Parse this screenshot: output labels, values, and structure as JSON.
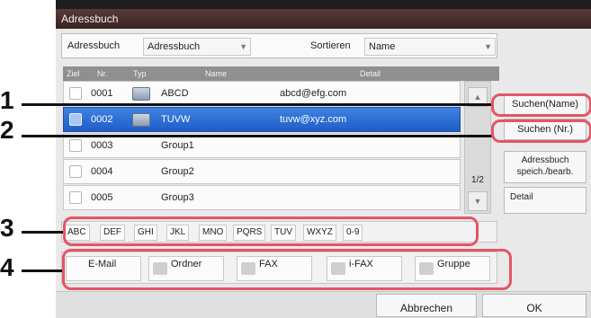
{
  "window": {
    "title": "Adressbuch"
  },
  "topbar": {
    "addressbook_label": "Adressbuch",
    "addressbook_value": "Adressbuch",
    "sort_label": "Sortieren",
    "sort_value": "Name"
  },
  "columns": {
    "target": "Ziel",
    "number": "Nr.",
    "type": "Typ",
    "name": "Name",
    "detail": "Detail"
  },
  "entries": [
    {
      "number": "0001",
      "type_icon": "email-contact-icon",
      "name": "ABCD",
      "detail": "abcd@efg.com",
      "selected": false
    },
    {
      "number": "0002",
      "type_icon": "email-contact-icon",
      "name": "TUVW",
      "detail": "tuvw@xyz.com",
      "selected": true
    },
    {
      "number": "0003",
      "type_icon": "group-icon",
      "name": "Group1",
      "detail": "",
      "selected": false
    },
    {
      "number": "0004",
      "type_icon": "group-icon",
      "name": "Group2",
      "detail": "",
      "selected": false
    },
    {
      "number": "0005",
      "type_icon": "group-icon",
      "name": "Group3",
      "detail": "",
      "selected": false
    }
  ],
  "pager": {
    "text": "1/2"
  },
  "side_buttons": {
    "search_name": "Suchen(Name)",
    "search_number": "Suchen (Nr.)",
    "store_edit": "Adressbuch speich./bearb.",
    "detail": "Detail"
  },
  "alpha_keys": [
    "ABC",
    "DEF",
    "GHI",
    "JKL",
    "MNO",
    "PQRS",
    "TUV",
    "WXYZ",
    "0-9"
  ],
  "type_filters": [
    "E-Mail",
    "Ordner",
    "FAX",
    "i-FAX",
    "Gruppe"
  ],
  "bottom": {
    "cancel": "Abbrechen",
    "ok": "OK"
  },
  "callouts": [
    "1",
    "2",
    "3",
    "4"
  ],
  "colors": {
    "selection": "#2a6ad6",
    "callout": "#e35665",
    "title_bar": "#4a2e2e"
  }
}
